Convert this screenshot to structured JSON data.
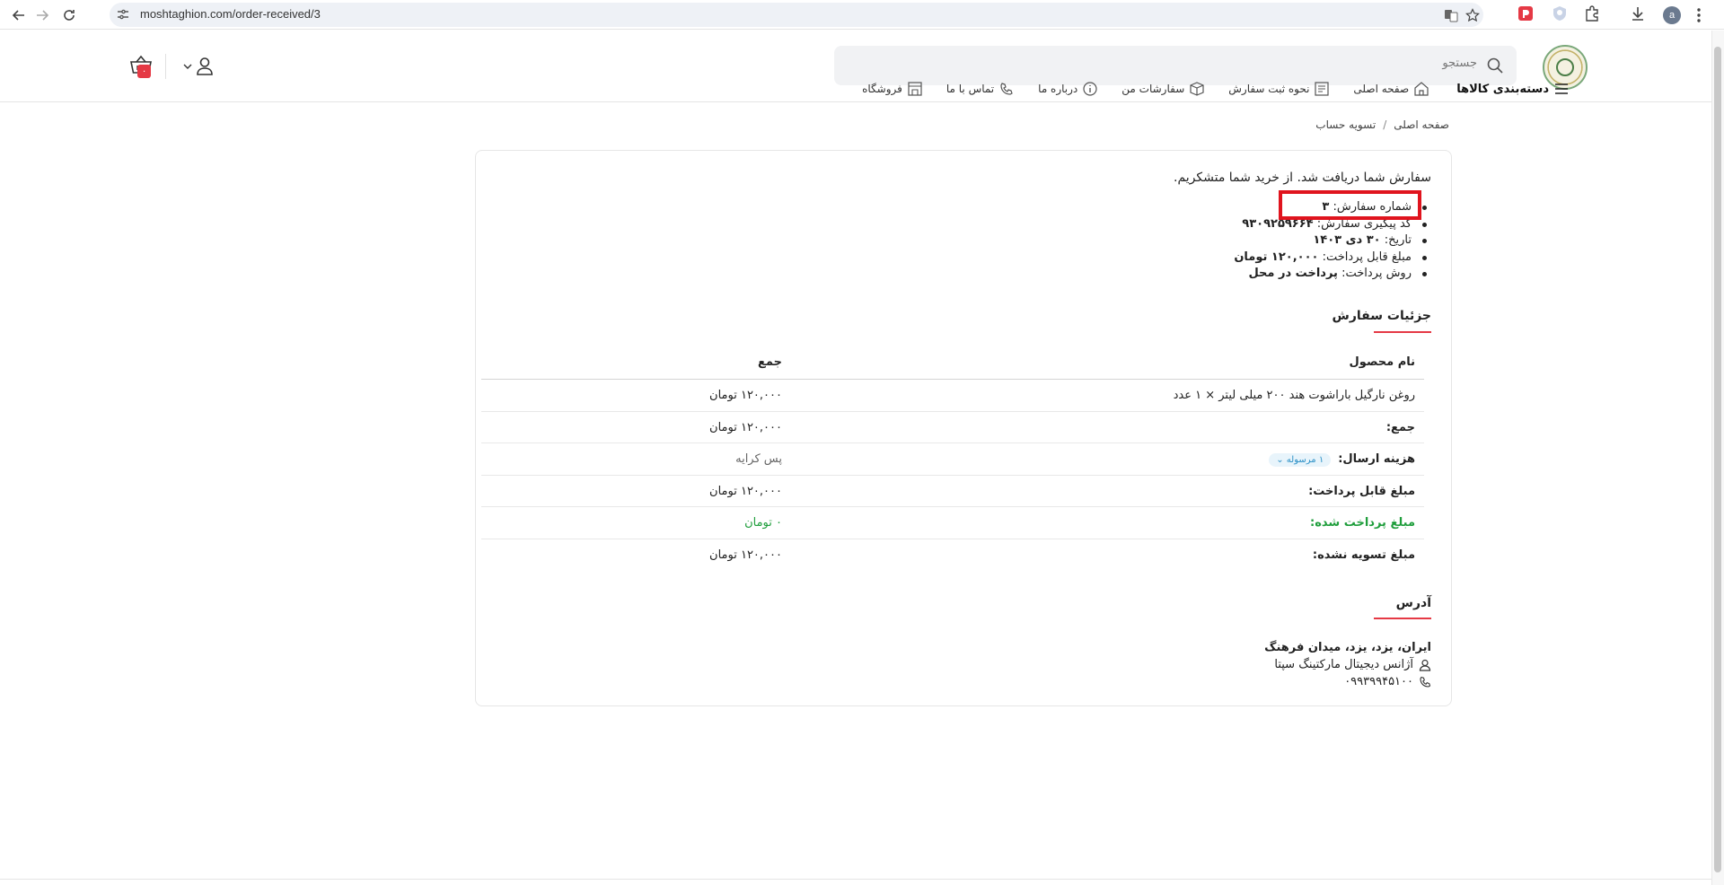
{
  "browser": {
    "url": "moshtaghion.com/order-received/3",
    "profile_initial": "a"
  },
  "header": {
    "search_placeholder": "جستجو",
    "cart_count": "۰",
    "menu": [
      {
        "label": "دسته‌بندی کالاها",
        "icon": "menu-icon"
      },
      {
        "label": "صفحه اصلی",
        "icon": "home-icon"
      },
      {
        "label": "نحوه ثبت سفارش",
        "icon": "form-icon"
      },
      {
        "label": "سفارشات من",
        "icon": "package-icon"
      },
      {
        "label": "درباره ما",
        "icon": "info-icon"
      },
      {
        "label": "تماس با ما",
        "icon": "phone-icon"
      },
      {
        "label": "فروشگاه",
        "icon": "store-icon"
      }
    ]
  },
  "breadcrumb": {
    "home": "صفحه اصلی",
    "separator": "/",
    "current": "تسویه حساب"
  },
  "order": {
    "thanks": "سفارش شما دریافت شد. از خرید شما متشکریم.",
    "summary": [
      {
        "label": "شماره سفارش:",
        "value": "۳"
      },
      {
        "label": "کد پیگیری سفارش:",
        "value": "۹۳۰۹۲۵۹۶۶۴"
      },
      {
        "label": "تاریخ:",
        "value": "۳۰ دی ۱۴۰۳"
      },
      {
        "label": "مبلغ قابل پرداخت:",
        "value": "۱۲۰,۰۰۰ تومان"
      },
      {
        "label": "روش پرداخت:",
        "value": "پرداخت در محل"
      }
    ]
  },
  "details": {
    "title": "جزئیات سفارش",
    "columns": [
      "نام محصول",
      "جمع"
    ],
    "rows": [
      {
        "name": "روغن نارگیل باراشوت هند ۲۰۰ میلی لیتر × ۱ عدد",
        "value": "۱۲۰,۰۰۰ تومان"
      },
      {
        "name": "جمع:",
        "value": "۱۲۰,۰۰۰ تومان"
      },
      {
        "name": "هزینه ارسال:",
        "pill": "۱ مرسوله ⌄",
        "value": "پس کرایه"
      },
      {
        "name": "مبلغ قابل پرداخت:",
        "value": "۱۲۰,۰۰۰ تومان"
      },
      {
        "name": "مبلغ پرداخت شده:",
        "value": "۰ تومان"
      },
      {
        "name": "مبلغ تسویه نشده:",
        "value": "۱۲۰,۰۰۰ تومان"
      }
    ]
  },
  "address": {
    "title": "آدرس",
    "location": "ایران، یزد، یزد، میدان فرهنگ",
    "name": "آژانس دیجیتال مارکتینگ سپتا",
    "phone": "۰۹۹۳۹۹۴۵۱۰۰"
  },
  "colors": {
    "accent": "#e53945",
    "highlight_box": "#e0141e",
    "paid_green": "#1f9e3c"
  }
}
